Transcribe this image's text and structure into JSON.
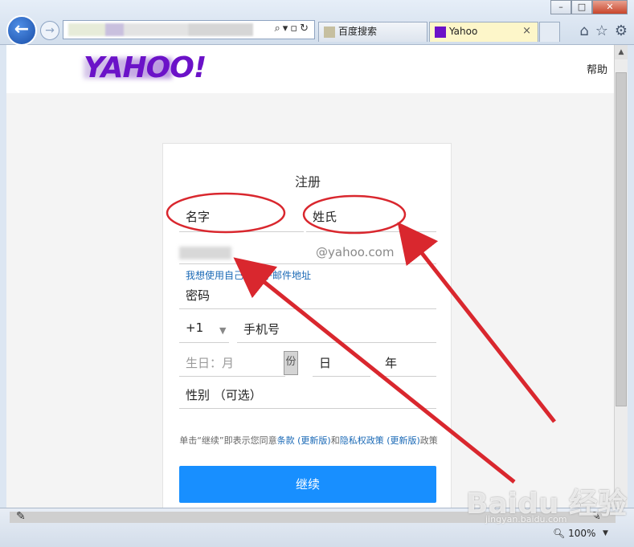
{
  "browser": {
    "window_controls": [
      "–",
      "□",
      "✕"
    ],
    "address_text": "",
    "tabs": [
      {
        "label": "百度搜索",
        "active": false
      },
      {
        "label": "Yahoo",
        "active": true
      }
    ],
    "tab_close": "×",
    "toolbar_icons": [
      "home-icon",
      "star-icon",
      "gear-icon"
    ],
    "zoom_level": "100%"
  },
  "page": {
    "logo_text": "YAHOO!",
    "help_label": "帮助",
    "signup": {
      "title": "注册",
      "first_name_placeholder": "名字",
      "last_name_placeholder": "姓氏",
      "email_suffix": "@yahoo.com",
      "own_email_link": "我想使用自己的电子邮件地址",
      "password_placeholder": "密码",
      "country_code": "+1",
      "phone_placeholder": "手机号",
      "birth_month_placeholder": "生日：月",
      "birth_month_arrow": "份",
      "birth_day_placeholder": "日",
      "birth_year_placeholder": "年",
      "gender_placeholder": "性别 （可选）",
      "terms_prefix": "单击“继续”即表示您同意",
      "terms_link": "条款 (更新版)",
      "terms_and": "和",
      "privacy_link": "隐私权政策 (更新版)",
      "terms_suffix": "政策",
      "continue_label": "继续"
    }
  },
  "watermark": {
    "text": "Baidu 经验",
    "sub": "jingyan.baidu.com"
  },
  "colors": {
    "yahoo_purple": "#6b12c8",
    "continue_blue": "#188fff",
    "link_blue": "#1a69b6",
    "annotation_red": "#d9272e"
  }
}
